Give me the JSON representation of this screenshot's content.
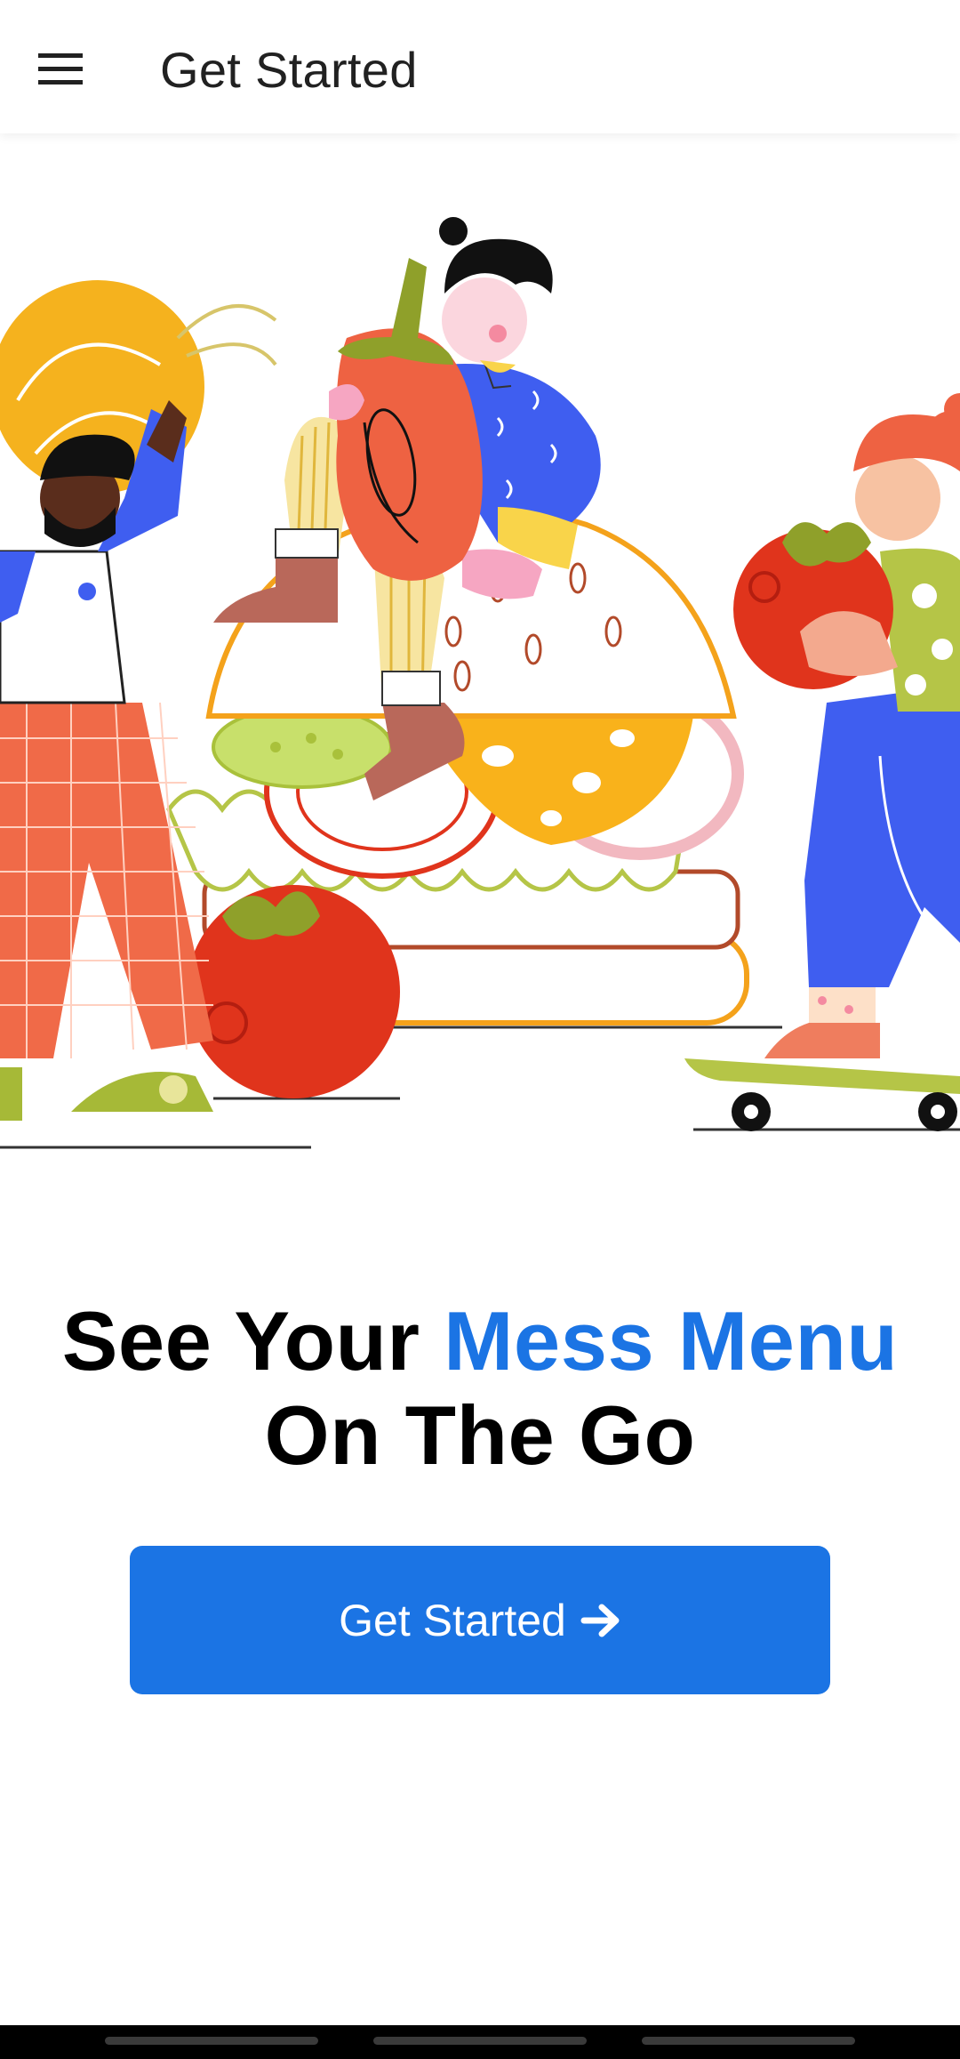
{
  "appbar": {
    "title": "Get Started",
    "menu_icon": "hamburger-menu-icon"
  },
  "hero": {
    "illustration": "people-carrying-food-burger-illustration"
  },
  "headline": {
    "line1_part1": "See Your",
    "line1_accent": "Mess Menu",
    "line2": "On The Go"
  },
  "cta": {
    "label": "Get Started",
    "icon": "arrow-right-icon"
  },
  "colors": {
    "accent": "#1b74e4",
    "text": "#000000",
    "appbar_text": "#212121"
  }
}
